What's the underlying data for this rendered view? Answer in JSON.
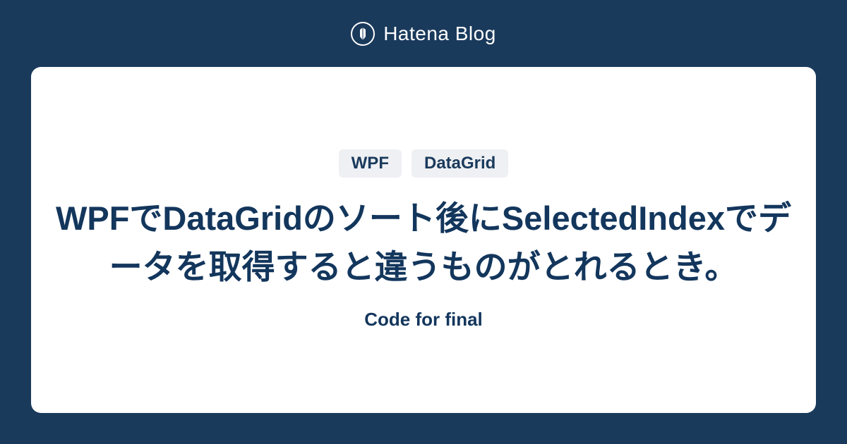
{
  "header": {
    "brand": "Hatena Blog"
  },
  "card": {
    "tags": [
      "WPF",
      "DataGrid"
    ],
    "title": "WPFでDataGridのソート後にSelectedIndexでデータを取得すると違うものがとれるとき。",
    "subtitle": "Code for final"
  },
  "colors": {
    "background": "#1a3a5c",
    "cardBg": "#ffffff",
    "text": "#13365c",
    "tagBg": "#eef0f3"
  }
}
